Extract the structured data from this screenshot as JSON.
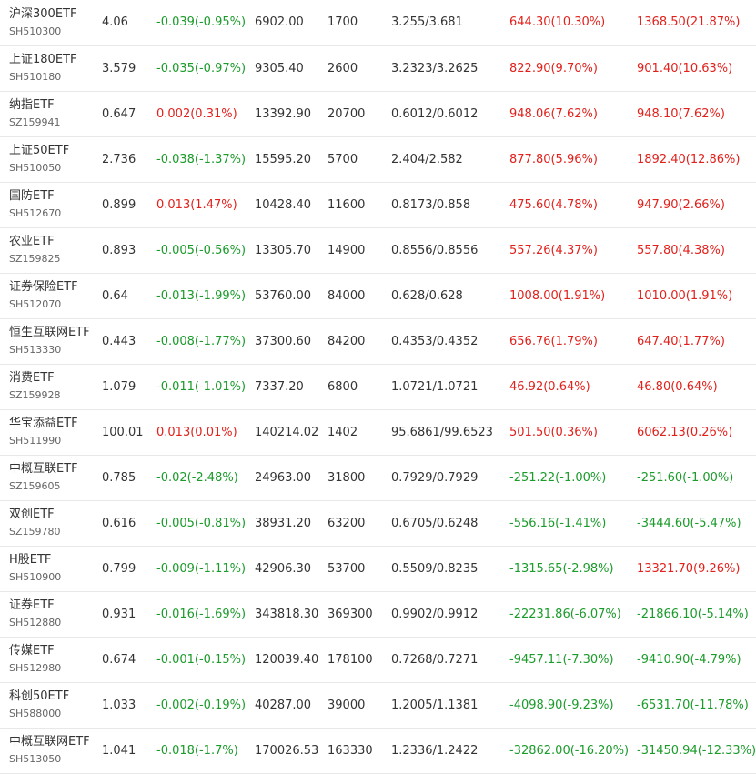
{
  "colors": {
    "up": "#e2211c",
    "down": "#1a9b2a",
    "text": "#333333"
  },
  "rows": [
    {
      "name": "沪深300ETF",
      "code": "SH510300",
      "price": "4.06",
      "change": "-0.039(-0.95%)",
      "change_dir": "down",
      "amount": "6902.00",
      "volume": "1700",
      "range": "3.255/3.681",
      "col7": "644.30(10.30%)",
      "col7_dir": "up",
      "col8": "1368.50(21.87%)",
      "col8_dir": "up"
    },
    {
      "name": "上证180ETF",
      "code": "SH510180",
      "price": "3.579",
      "change": "-0.035(-0.97%)",
      "change_dir": "down",
      "amount": "9305.40",
      "volume": "2600",
      "range": "3.2323/3.2625",
      "col7": "822.90(9.70%)",
      "col7_dir": "up",
      "col8": "901.40(10.63%)",
      "col8_dir": "up"
    },
    {
      "name": "纳指ETF",
      "code": "SZ159941",
      "price": "0.647",
      "change": "0.002(0.31%)",
      "change_dir": "up",
      "amount": "13392.90",
      "volume": "20700",
      "range": "0.6012/0.6012",
      "col7": "948.06(7.62%)",
      "col7_dir": "up",
      "col8": "948.10(7.62%)",
      "col8_dir": "up"
    },
    {
      "name": "上证50ETF",
      "code": "SH510050",
      "price": "2.736",
      "change": "-0.038(-1.37%)",
      "change_dir": "down",
      "amount": "15595.20",
      "volume": "5700",
      "range": "2.404/2.582",
      "col7": "877.80(5.96%)",
      "col7_dir": "up",
      "col8": "1892.40(12.86%)",
      "col8_dir": "up"
    },
    {
      "name": "国防ETF",
      "code": "SH512670",
      "price": "0.899",
      "change": "0.013(1.47%)",
      "change_dir": "up",
      "amount": "10428.40",
      "volume": "11600",
      "range": "0.8173/0.858",
      "col7": "475.60(4.78%)",
      "col7_dir": "up",
      "col8": "947.90(2.66%)",
      "col8_dir": "up"
    },
    {
      "name": "农业ETF",
      "code": "SZ159825",
      "price": "0.893",
      "change": "-0.005(-0.56%)",
      "change_dir": "down",
      "amount": "13305.70",
      "volume": "14900",
      "range": "0.8556/0.8556",
      "col7": "557.26(4.37%)",
      "col7_dir": "up",
      "col8": "557.80(4.38%)",
      "col8_dir": "up"
    },
    {
      "name": "证券保险ETF",
      "code": "SH512070",
      "price": "0.64",
      "change": "-0.013(-1.99%)",
      "change_dir": "down",
      "amount": "53760.00",
      "volume": "84000",
      "range": "0.628/0.628",
      "col7": "1008.00(1.91%)",
      "col7_dir": "up",
      "col8": "1010.00(1.91%)",
      "col8_dir": "up"
    },
    {
      "name": "恒生互联网ETF",
      "code": "SH513330",
      "price": "0.443",
      "change": "-0.008(-1.77%)",
      "change_dir": "down",
      "amount": "37300.60",
      "volume": "84200",
      "range": "0.4353/0.4352",
      "col7": "656.76(1.79%)",
      "col7_dir": "up",
      "col8": "647.40(1.77%)",
      "col8_dir": "up"
    },
    {
      "name": "消费ETF",
      "code": "SZ159928",
      "price": "1.079",
      "change": "-0.011(-1.01%)",
      "change_dir": "down",
      "amount": "7337.20",
      "volume": "6800",
      "range": "1.0721/1.0721",
      "col7": "46.92(0.64%)",
      "col7_dir": "up",
      "col8": "46.80(0.64%)",
      "col8_dir": "up"
    },
    {
      "name": "华宝添益ETF",
      "code": "SH511990",
      "price": "100.01",
      "change": "0.013(0.01%)",
      "change_dir": "up",
      "amount": "140214.02",
      "volume": "1402",
      "range": "95.6861/99.6523",
      "col7": "501.50(0.36%)",
      "col7_dir": "up",
      "col8": "6062.13(0.26%)",
      "col8_dir": "up"
    },
    {
      "name": "中概互联ETF",
      "code": "SZ159605",
      "price": "0.785",
      "change": "-0.02(-2.48%)",
      "change_dir": "down",
      "amount": "24963.00",
      "volume": "31800",
      "range": "0.7929/0.7929",
      "col7": "-251.22(-1.00%)",
      "col7_dir": "down",
      "col8": "-251.60(-1.00%)",
      "col8_dir": "down"
    },
    {
      "name": "双创ETF",
      "code": "SZ159780",
      "price": "0.616",
      "change": "-0.005(-0.81%)",
      "change_dir": "down",
      "amount": "38931.20",
      "volume": "63200",
      "range": "0.6705/0.6248",
      "col7": "-556.16(-1.41%)",
      "col7_dir": "down",
      "col8": "-3444.60(-5.47%)",
      "col8_dir": "down"
    },
    {
      "name": "H股ETF",
      "code": "SH510900",
      "price": "0.799",
      "change": "-0.009(-1.11%)",
      "change_dir": "down",
      "amount": "42906.30",
      "volume": "53700",
      "range": "0.5509/0.8235",
      "col7": "-1315.65(-2.98%)",
      "col7_dir": "down",
      "col8": "13321.70(9.26%)",
      "col8_dir": "up"
    },
    {
      "name": "证券ETF",
      "code": "SH512880",
      "price": "0.931",
      "change": "-0.016(-1.69%)",
      "change_dir": "down",
      "amount": "343818.30",
      "volume": "369300",
      "range": "0.9902/0.9912",
      "col7": "-22231.86(-6.07%)",
      "col7_dir": "down",
      "col8": "-21866.10(-5.14%)",
      "col8_dir": "down"
    },
    {
      "name": "传媒ETF",
      "code": "SH512980",
      "price": "0.674",
      "change": "-0.001(-0.15%)",
      "change_dir": "down",
      "amount": "120039.40",
      "volume": "178100",
      "range": "0.7268/0.7271",
      "col7": "-9457.11(-7.30%)",
      "col7_dir": "down",
      "col8": "-9410.90(-4.79%)",
      "col8_dir": "down"
    },
    {
      "name": "科创50ETF",
      "code": "SH588000",
      "price": "1.033",
      "change": "-0.002(-0.19%)",
      "change_dir": "down",
      "amount": "40287.00",
      "volume": "39000",
      "range": "1.2005/1.1381",
      "col7": "-4098.90(-9.23%)",
      "col7_dir": "down",
      "col8": "-6531.70(-11.78%)",
      "col8_dir": "down"
    },
    {
      "name": "中概互联网ETF",
      "code": "SH513050",
      "price": "1.041",
      "change": "-0.018(-1.7%)",
      "change_dir": "down",
      "amount": "170026.53",
      "volume": "163330",
      "range": "1.2336/1.2422",
      "col7": "-32862.00(-16.20%)",
      "col7_dir": "down",
      "col8": "-31450.94(-12.33%)",
      "col8_dir": "down"
    }
  ]
}
